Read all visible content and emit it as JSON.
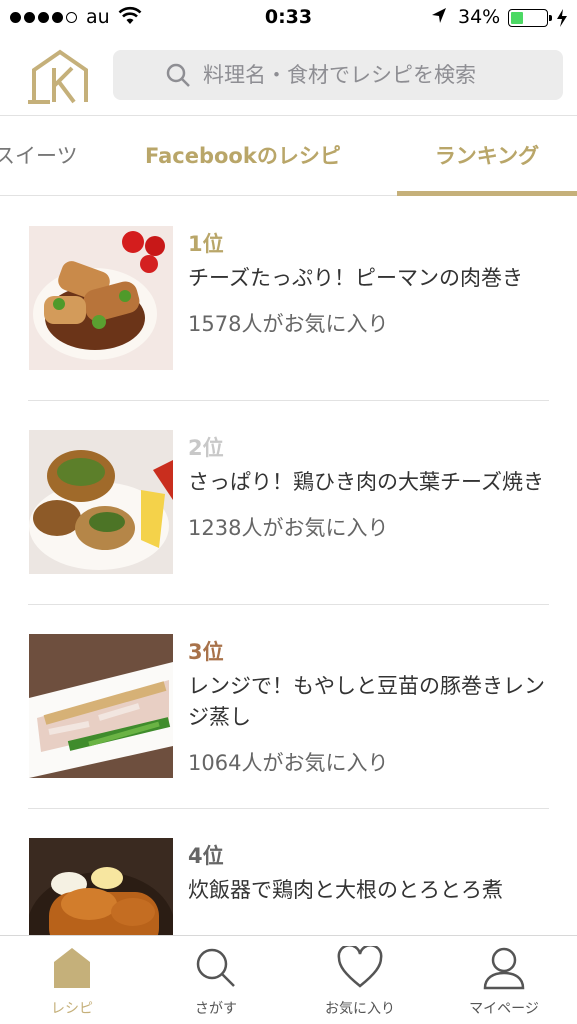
{
  "status_bar": {
    "carrier": "au",
    "time": "0:33",
    "battery_percent": "34%",
    "battery_level": 0.34,
    "signal_bars_filled": 4,
    "signal_bars_total": 5
  },
  "header": {
    "logo_icon": "house-k-logo",
    "search_placeholder": "料理名・食材でレシピを検索"
  },
  "tabs": [
    {
      "label": "スイーツ",
      "active": false
    },
    {
      "label": "Facebookのレシピ",
      "active": false
    },
    {
      "label": "ランキング",
      "active": true
    }
  ],
  "recipes": [
    {
      "rank": "1位",
      "rank_color": "#b9a669",
      "title": "チーズたっぷり！ピーマンの肉巻き",
      "favorites": "1578人がお気に入り"
    },
    {
      "rank": "2位",
      "rank_color": "#c8c8c8",
      "title": "さっぱり！鶏ひき肉の大葉チーズ焼き",
      "favorites": "1238人がお気に入り"
    },
    {
      "rank": "3位",
      "rank_color": "#a8724a",
      "title": "レンジで！もやしと豆苗の豚巻きレンジ蒸し",
      "favorites": "1064人がお気に入り"
    },
    {
      "rank": "4位",
      "rank_color": "#666666",
      "title": "炊飯器で鶏肉と大根のとろとろ煮",
      "favorites": ""
    }
  ],
  "bottom_nav": [
    {
      "label": "レシピ",
      "icon": "home-icon",
      "active": true
    },
    {
      "label": "さがす",
      "icon": "search-icon",
      "active": false
    },
    {
      "label": "お気に入り",
      "icon": "heart-icon",
      "active": false
    },
    {
      "label": "マイページ",
      "icon": "person-icon",
      "active": false
    }
  ],
  "colors": {
    "accent": "#c5b07a",
    "search_bg": "#ececec",
    "battery_fill": "#4cd964"
  }
}
